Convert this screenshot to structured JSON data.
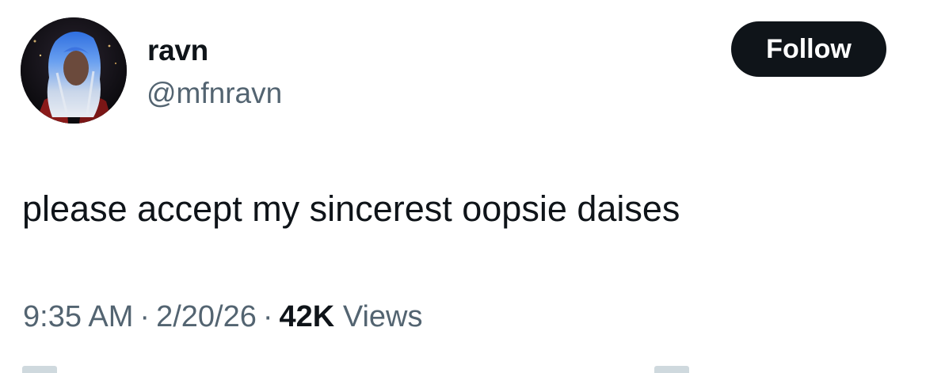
{
  "author": {
    "display_name": "ravn",
    "handle": "@mfnravn"
  },
  "follow_button": {
    "label": "Follow",
    "bg_color": "#0f1419",
    "text_color": "#ffffff"
  },
  "tweet": {
    "text": "please accept my sincerest oopsie daises"
  },
  "meta": {
    "time": "9:35 AM",
    "date": "2/20/26",
    "views_count": "42K",
    "views_label": "Views",
    "separator": "·"
  },
  "colors": {
    "primary_text": "#0f1419",
    "secondary_text": "#536471",
    "background": "#ffffff"
  }
}
